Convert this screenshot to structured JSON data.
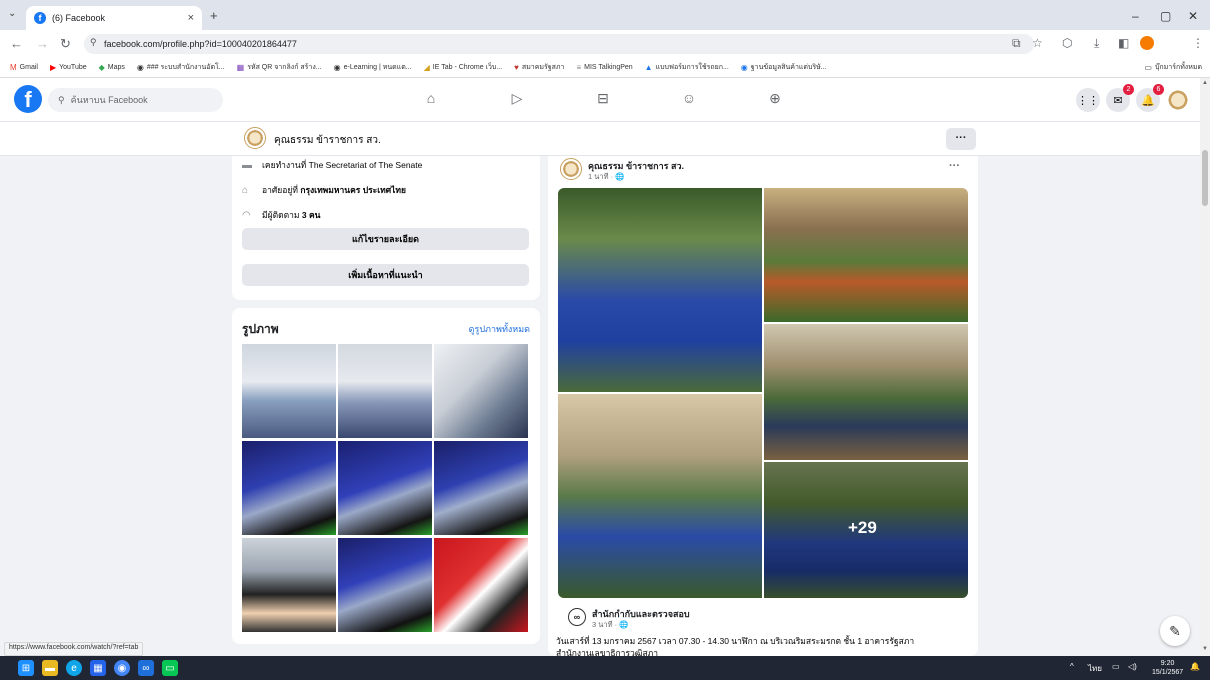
{
  "browser": {
    "tab_title": "(6) Facebook",
    "tab_close": "×",
    "new_tab": "+",
    "url": "facebook.com/profile.php?id=100040201864477",
    "window_controls": [
      "–",
      "▢",
      "✕"
    ]
  },
  "bookmarks": [
    {
      "icon": "gmail-icon",
      "label": "Gmail",
      "glyph": "M",
      "color": "#ea4335"
    },
    {
      "icon": "youtube-icon",
      "label": "YouTube",
      "glyph": "▶",
      "color": "#ff0000"
    },
    {
      "icon": "maps-icon",
      "label": "Maps",
      "glyph": "◆",
      "color": "#34a853"
    },
    {
      "icon": "globe-icon",
      "label": "### ระบบสำนักงานอัตโ...",
      "glyph": "◉",
      "color": "#333"
    },
    {
      "icon": "qr-icon",
      "label": "รหัส QR จากลิงก์ สร้าง...",
      "glyph": "▦",
      "color": "#7b3fb8"
    },
    {
      "icon": "elearning-icon",
      "label": "e-Learning | หนดแต...",
      "glyph": "◉",
      "color": "#333"
    },
    {
      "icon": "ietab-icon",
      "label": "IE Tab - Chrome เว็บ...",
      "glyph": "◢",
      "color": "#d4a017"
    },
    {
      "icon": "senate-icon",
      "label": "สมาคมรัฐสภา",
      "glyph": "♥",
      "color": "#c0392b"
    },
    {
      "icon": "mis-icon",
      "label": "MIS TalkingPen",
      "glyph": "≡",
      "color": "#888"
    },
    {
      "icon": "drive-icon",
      "label": "แบบฟอร์มการใช้รถยก...",
      "glyph": "▲",
      "color": "#1a73e8"
    },
    {
      "icon": "database-icon",
      "label": "ฐานข้อมูลสินค้าแต่บริษั...",
      "glyph": "◉",
      "color": "#1a73e8"
    }
  ],
  "bookmarks_folder": "บุ๊กมาร์กทั้งหมด",
  "facebook": {
    "search_placeholder": "ค้นหาบน Facebook",
    "messenger_badge": "2",
    "notifications_badge": "6"
  },
  "profile": {
    "name": "คุณธรรม ข้าราชการ สว.",
    "more": "···"
  },
  "intro": {
    "work": "เคยทำงานที่ The Secretariat of The Senate",
    "lives_prefix": "อาศัยอยู่ที่ ",
    "lives_place": "กรุงเทพมหานคร ประเทศไทย",
    "followers_prefix": "มีผู้ติดตาม ",
    "followers_count": "3 คน",
    "edit_details": "แก้ไขรายละเอียด",
    "add_featured": "เพิ่มเนื้อหาที่แนะนำ"
  },
  "photos": {
    "title": "รูปภาพ",
    "see_all": "ดูรูปภาพทั้งหมด"
  },
  "post": {
    "author": "คุณธรรม ข้าราชการ สว.",
    "time": "1 นาที · 🌐",
    "more": "···",
    "extra_photos": "+29",
    "shared_from": "สำนักกำกับและตรวจสอบ",
    "shared_time": "3 นาที · 🌐",
    "text_line1": "วันเสาร์ที่ 13 มกราคม 2567 เวลา 07.30 - 14.30 นาฬิกา ณ บริเวณริมสระมรกต ชั้น 1 อาคารรัฐสภา",
    "text_line2": "สำนักงานเลขาธิการวุฒิสภา"
  },
  "status_url": "https://www.facebook.com/watch/?ref=tab",
  "taskbar": {
    "lang": "ไทย",
    "time": "9:20",
    "date": "15/1/2567"
  },
  "colors": {
    "fb_blue": "#1877f2",
    "link": "#216fdb",
    "badge_red": "#e41e3f",
    "taskbar": "#202634"
  }
}
